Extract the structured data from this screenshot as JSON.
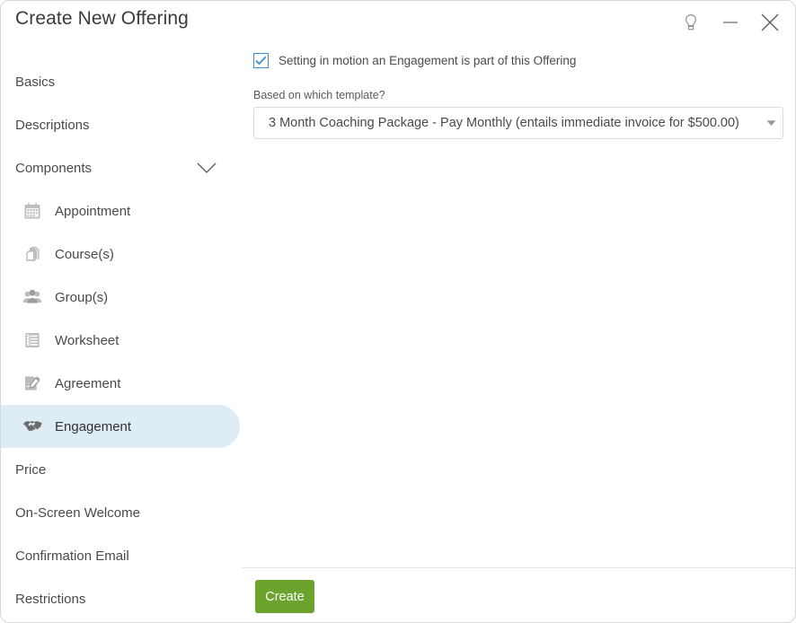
{
  "window": {
    "title": "Create New Offering",
    "controls": [
      {
        "name": "hint-lightbulb-icon",
        "label": "Hint"
      },
      {
        "name": "minimize-icon",
        "label": "Minimize"
      },
      {
        "name": "close-icon",
        "label": "Close"
      }
    ]
  },
  "sidebar": {
    "items": [
      {
        "label": "Basics",
        "icon": null,
        "selected": false,
        "sub": false
      },
      {
        "label": "Descriptions",
        "icon": null,
        "selected": false,
        "sub": false
      },
      {
        "label": "Components",
        "icon": null,
        "selected": false,
        "sub": false,
        "expander": "chevron-down"
      },
      {
        "label": "Appointment",
        "icon": "calendar-icon",
        "selected": false,
        "sub": true
      },
      {
        "label": "Course(s)",
        "icon": "pages-icon",
        "selected": false,
        "sub": true
      },
      {
        "label": "Group(s)",
        "icon": "group-icon",
        "selected": false,
        "sub": true
      },
      {
        "label": "Worksheet",
        "icon": "worksheet-icon",
        "selected": false,
        "sub": true
      },
      {
        "label": "Agreement",
        "icon": "agreement-icon",
        "selected": false,
        "sub": true
      },
      {
        "label": "Engagement",
        "icon": "handshake-icon",
        "selected": true,
        "sub": true
      },
      {
        "label": "Price",
        "icon": null,
        "selected": false,
        "sub": false
      },
      {
        "label": "On-Screen Welcome",
        "icon": null,
        "selected": false,
        "sub": false
      },
      {
        "label": "Confirmation Email",
        "icon": null,
        "selected": false,
        "sub": false
      },
      {
        "label": "Restrictions",
        "icon": null,
        "selected": false,
        "sub": false
      }
    ]
  },
  "main": {
    "engagement_checkbox": {
      "label": "Setting in motion an Engagement is part of this Offering",
      "checked": true
    },
    "template_field": {
      "label": "Based on which template?",
      "value": "3 Month Coaching Package - Pay Monthly (entails immediate invoice for $500.00)"
    }
  },
  "footer": {
    "create_label": "Create"
  },
  "colors": {
    "accent_green": "#6ba32d",
    "checkbox_blue": "#3f8fd0",
    "selected_pill": "#ddecf5",
    "text": "#4a4a4a",
    "border": "#dcdcdc"
  }
}
